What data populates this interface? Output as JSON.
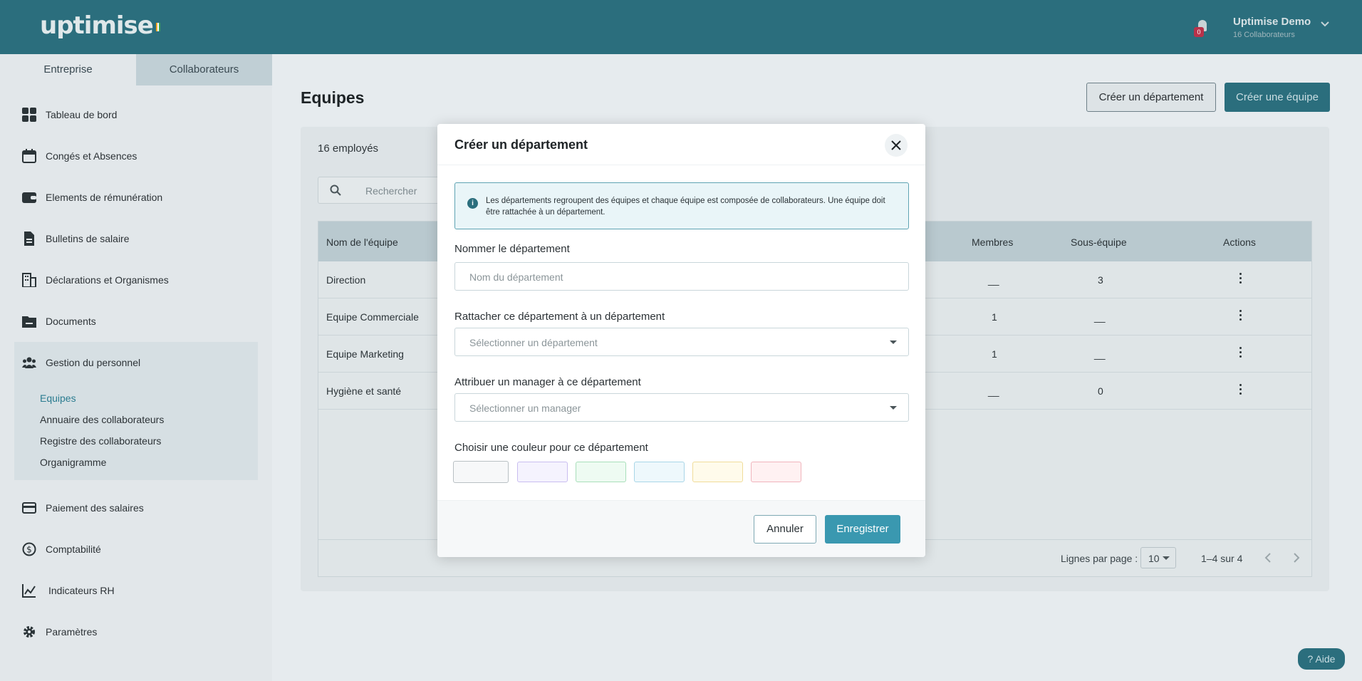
{
  "header": {
    "logo": "uptimise",
    "notification_count": "0",
    "user_name": "Uptimise Demo",
    "user_subtitle": "16 Collaborateurs"
  },
  "sidebar": {
    "tabs": [
      {
        "label": "Entreprise"
      },
      {
        "label": "Collaborateurs"
      }
    ],
    "items": [
      {
        "label": "Tableau de bord",
        "icon": "dashboard-icon"
      },
      {
        "label": "Congés et Absences",
        "icon": "calendar-icon"
      },
      {
        "label": "Elements de rémunération",
        "icon": "wallet-icon"
      },
      {
        "label": "Bulletins de salaire",
        "icon": "file-icon"
      },
      {
        "label": "Déclarations et Organismes",
        "icon": "building-icon"
      },
      {
        "label": "Documents",
        "icon": "folder-icon"
      },
      {
        "label": "Gestion du personnel",
        "icon": "people-icon"
      },
      {
        "label": "Paiement des salaires",
        "icon": "card-icon"
      },
      {
        "label": "Comptabilité",
        "icon": "dollar-icon"
      },
      {
        "label": "Indicateurs RH",
        "icon": "chart-icon"
      },
      {
        "label": "Paramètres",
        "icon": "gear-icon"
      }
    ],
    "subitems": [
      {
        "label": "Equipes"
      },
      {
        "label": "Annuaire des collaborateurs"
      },
      {
        "label": "Registre des collaborateurs"
      },
      {
        "label": "Organigramme"
      }
    ]
  },
  "main": {
    "title": "Equipes",
    "btn_create_department": "Créer un département",
    "btn_create_team": "Créer une équipe",
    "employee_count": "16 employés",
    "search_placeholder": "Rechercher",
    "columns": {
      "name": "Nom de l'équipe",
      "members": "Membres",
      "subteam": "Sous-équipe",
      "actions": "Actions"
    },
    "rows": [
      {
        "name": "Direction",
        "members": "__",
        "subteam": "3"
      },
      {
        "name": "Equipe Commerciale",
        "members": "1",
        "subteam": "__"
      },
      {
        "name": "Equipe Marketing",
        "members": "1",
        "subteam": "__"
      },
      {
        "name": "Hygiène et santé",
        "members": "__",
        "subteam": "0"
      }
    ],
    "footer": {
      "rows_per_page_label": "Lignes par page :",
      "rows_per_page": "10",
      "range": "1–4 sur 4"
    }
  },
  "help_label": "Aide",
  "modal": {
    "title": "Créer un département",
    "info": "Les départements regroupent des équipes et chaque équipe est composée de collaborateurs. Une équipe doit être rattachée à un département.",
    "name_label": "Nommer le département",
    "name_placeholder": "Nom du département",
    "parent_label": "Rattacher ce département à un département",
    "parent_placeholder": "Sélectionner un département",
    "manager_label": "Attribuer un manager à ce département",
    "manager_placeholder": "Sélectionner un manager",
    "color_label": "Choisir une couleur pour ce département",
    "colors": [
      {
        "fill": "#f7f8f9",
        "border": "#b9c0c4"
      },
      {
        "fill": "#f5f3fe",
        "border": "#c9bdf0"
      },
      {
        "fill": "#eefbf2",
        "border": "#a9dfba"
      },
      {
        "fill": "#eef8fc",
        "border": "#a9d6e8"
      },
      {
        "fill": "#fffbeb",
        "border": "#f0dc9a"
      },
      {
        "fill": "#fff1f2",
        "border": "#f0b4bc"
      }
    ],
    "cancel": "Annuler",
    "save": "Enregistrer"
  }
}
